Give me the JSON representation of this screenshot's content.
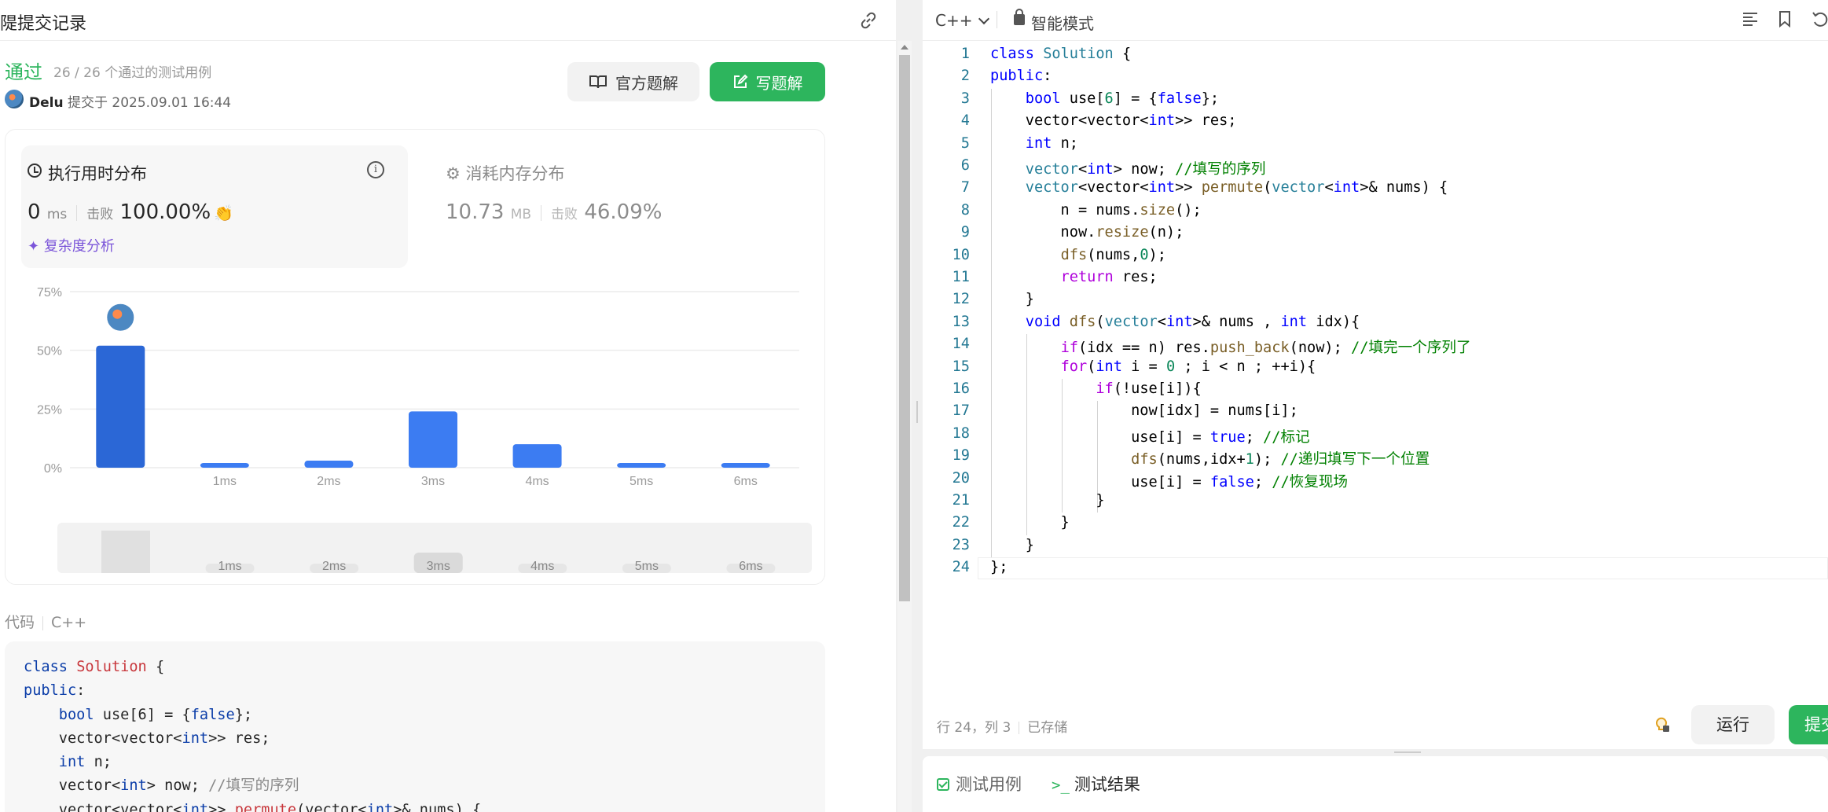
{
  "left_panel": {
    "title": "隄提交记录",
    "status": "通过",
    "cases": "26 / 26 个通过的测试用例",
    "user": "Delu",
    "submitted": "提交于 2025.09.01 16:44",
    "editorial_btn": "官方题解",
    "write_btn": "写题解"
  },
  "runtime": {
    "title": "执行用时分布",
    "value": "0",
    "unit": "ms",
    "beat_label": "击败",
    "beat": "100.00%",
    "complexity": "复杂度分析"
  },
  "memory": {
    "title": "消耗内存分布",
    "value": "10.73",
    "unit": "MB",
    "beat_label": "击败",
    "beat": "46.09%"
  },
  "chart_data": {
    "type": "bar",
    "categories": [
      "",
      "1ms",
      "2ms",
      "3ms",
      "4ms",
      "5ms",
      "6ms"
    ],
    "values": [
      52,
      2,
      3,
      24,
      10,
      2,
      2
    ],
    "highlight_index": 0,
    "ylim": [
      0,
      75
    ],
    "yticks": [
      "0%",
      "25%",
      "50%",
      "75%"
    ],
    "grid": true,
    "colors": {
      "highlight": "#2b67d6",
      "bar": "#3c7cf2",
      "grid": "#ececec"
    }
  },
  "mini_chart": {
    "labels": [
      "1ms",
      "2ms",
      "3ms",
      "4ms",
      "5ms",
      "6ms"
    ]
  },
  "code_section": {
    "label": "代码",
    "lang": "C++",
    "lines": [
      "class Solution {",
      "public:",
      "    bool use[6] = {false};",
      "    vector<vector<int>> res;",
      "    int n;",
      "    vector<int> now; //填写的序列",
      "    vector<vector<int>> permute(vector<int>& nums) {"
    ]
  },
  "editor": {
    "lang": "C++",
    "mode": "智能模式",
    "status_pos": "行 24，列 3",
    "status_saved": "已存储",
    "run": "运行",
    "submit": "提交"
  },
  "bottom_tabs": {
    "tab1": "测试用例",
    "tab2": "测试结果"
  },
  "colors": {
    "accent": "#2db55d",
    "purple": "#7b55d9"
  }
}
